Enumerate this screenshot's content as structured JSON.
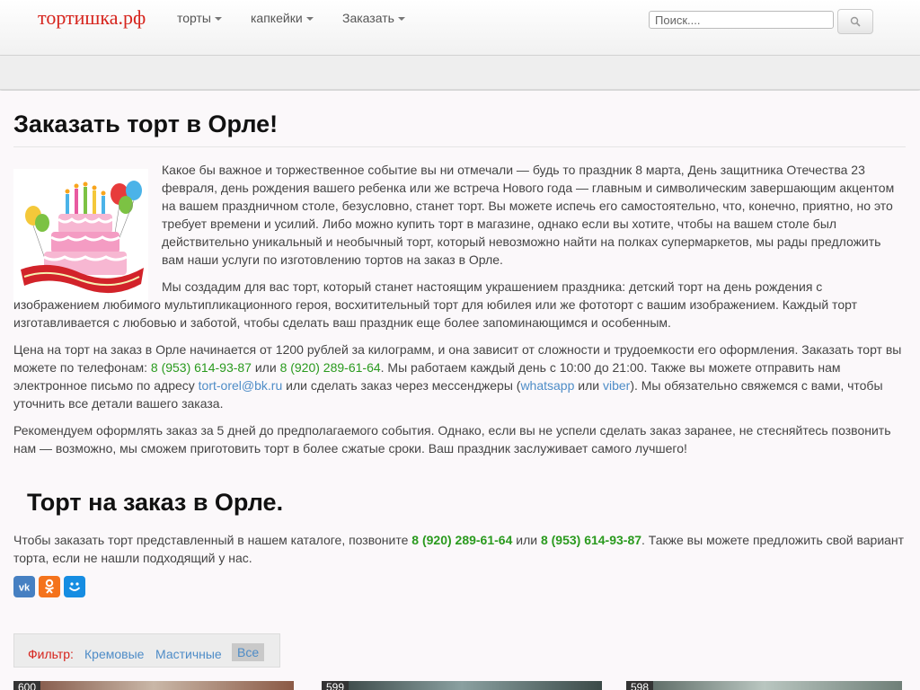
{
  "brand": "тортишка.рф",
  "nav": {
    "items": [
      {
        "label": "торты"
      },
      {
        "label": "капкейки"
      },
      {
        "label": "Заказать"
      }
    ],
    "search_placeholder": "Поиск...."
  },
  "page": {
    "title": "Заказать торт в Орле!",
    "p1": "Какое бы важное и торжественное событие вы ни отмечали — будь то праздник 8 марта, День защитника Отечества 23 февраля, день рождения вашего ребенка или же встреча Нового года — главным и символическим завершающим акцентом на вашем праздничном столе, безусловно, станет торт. Вы можете испечь его самостоятельно, что, конечно, приятно, но это требует времени и усилий. Либо можно купить торт в магазине, однако если вы хотите, чтобы на вашем столе был действительно уникальный и необычный торт, который невозможно найти на полках супермаркетов, мы рады предложить вам наши услуги по изготовлению тортов на заказ в Орле.",
    "p2": "Мы создадим для вас торт, который станет настоящим украшением праздника: детский торт на день рождения с изображением любимого мультипликационного героя, восхитительный торт для юбилея или же фототорт с вашим изображением. Каждый торт изготавливается с любовью и заботой, чтобы сделать ваш праздник еще более запоминающимся и особенным.",
    "p3": {
      "t1": "Цена на торт на заказ в Орле начинается от 1200 рублей за килограмм, и она зависит от сложности и трудоемкости его оформления. Заказать торт вы можете по телефонам: ",
      "phone1": "8 (953) 614-93-87",
      "t2": " или ",
      "phone2": "8 (920) 289-61-64",
      "t3": ". Мы работаем каждый день с 10:00 до 21:00. Также вы можете отправить нам электронное письмо по адресу ",
      "email": "tort-orel@bk.ru",
      "t4": " или сделать заказ через мессенджеры (",
      "whatsapp": "whatsapp",
      "t5": " или ",
      "viber": "viber",
      "t6": "). Мы обязательно свяжемся с вами, чтобы уточнить все детали вашего заказа."
    },
    "p4": "Рекомендуем оформлять заказ за 5 дней до предполагаемого события. Однако, если вы не успели сделать заказ заранее, не стесняйтесь позвонить нам — возможно, мы сможем приготовить торт в более сжатые сроки. Ваш праздник заслуживает самого лучшего!",
    "subtitle": "Торт на заказ в Орле.",
    "p5": {
      "t1": "Чтобы заказать торт представленный в нашем каталоге, позвоните ",
      "phone1": "8 (920) 289-61-64",
      "t2": " или ",
      "phone2": "8 (953) 614-93-87",
      "t3": ". Также вы можете предложить свой вариант торта, если не нашли подходящий у нас."
    }
  },
  "share": {
    "icons": [
      "vk-icon",
      "odnoklassniki-icon",
      "moimir-icon"
    ],
    "colors": [
      "#4680c2",
      "#f4731c",
      "#168de2"
    ]
  },
  "filter": {
    "label": "Фильтр:",
    "options": [
      "Кремовые",
      "Мастичные",
      "Все"
    ],
    "active": "Все"
  },
  "products": [
    {
      "num": "600"
    },
    {
      "num": "599"
    },
    {
      "num": "598"
    }
  ],
  "colors": {
    "brand": "#d6231c",
    "link": "#4e8cc7",
    "phone": "#2a9a1e"
  }
}
